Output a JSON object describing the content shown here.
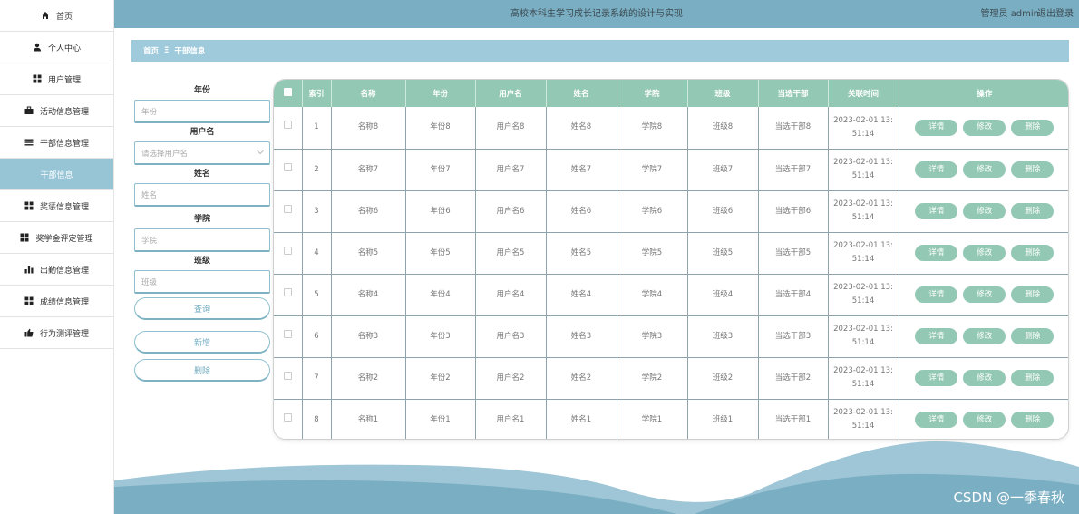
{
  "sidebar": {
    "items": [
      {
        "label": "首页",
        "icon": "home-icon"
      },
      {
        "label": "个人中心",
        "icon": "user-icon"
      },
      {
        "label": "用户管理",
        "icon": "grid-icon"
      },
      {
        "label": "活动信息管理",
        "icon": "briefcase-icon"
      },
      {
        "label": "干部信息管理",
        "icon": "list-icon"
      },
      {
        "label": "干部信息",
        "icon": "",
        "active": true
      },
      {
        "label": "奖惩信息管理",
        "icon": "grid-icon"
      },
      {
        "label": "奖学金评定管理",
        "icon": "grid-icon"
      },
      {
        "label": "出勤信息管理",
        "icon": "bar-chart-icon"
      },
      {
        "label": "成绩信息管理",
        "icon": "grid-icon"
      },
      {
        "label": "行为测评管理",
        "icon": "thumbs-up-icon"
      }
    ]
  },
  "header": {
    "title": "高校本科生学习成长记录系统的设计与实现",
    "user": "管理员 admin",
    "logout": "退出登录"
  },
  "breadcrumb": {
    "home": "首页",
    "separator": "Ξ",
    "current": "干部信息"
  },
  "search": {
    "year_label": "年份",
    "year_placeholder": "年份",
    "username_label": "用户名",
    "username_placeholder": "请选择用户名",
    "name_label": "姓名",
    "name_placeholder": "姓名",
    "college_label": "学院",
    "college_placeholder": "学院",
    "class_label": "班级",
    "class_placeholder": "班级",
    "query_button": "查询",
    "add_button": "新增",
    "delete_button": "删除"
  },
  "table": {
    "columns": [
      "索引",
      "名称",
      "年份",
      "用户名",
      "姓名",
      "学院",
      "班级",
      "当选干部",
      "关联时间",
      "操作"
    ],
    "rows": [
      [
        "1",
        "名称8",
        "年份8",
        "用户名8",
        "姓名8",
        "学院8",
        "班级8",
        "当选干部8",
        "2023-02-01 13:",
        "51:14"
      ],
      [
        "2",
        "名称7",
        "年份7",
        "用户名7",
        "姓名7",
        "学院7",
        "班级7",
        "当选干部7",
        "2023-02-01 13:",
        "51:14"
      ],
      [
        "3",
        "名称6",
        "年份6",
        "用户名6",
        "姓名6",
        "学院6",
        "班级6",
        "当选干部6",
        "2023-02-01 13:",
        "51:14"
      ],
      [
        "4",
        "名称5",
        "年份5",
        "用户名5",
        "姓名5",
        "学院5",
        "班级5",
        "当选干部5",
        "2023-02-01 13:",
        "51:14"
      ],
      [
        "5",
        "名称4",
        "年份4",
        "用户名4",
        "姓名4",
        "学院4",
        "班级4",
        "当选干部4",
        "2023-02-01 13:",
        "51:14"
      ],
      [
        "6",
        "名称3",
        "年份3",
        "用户名3",
        "姓名3",
        "学院3",
        "班级3",
        "当选干部3",
        "2023-02-01 13:",
        "51:14"
      ],
      [
        "7",
        "名称2",
        "年份2",
        "用户名2",
        "姓名2",
        "学院2",
        "班级2",
        "当选干部2",
        "2023-02-01 13:",
        "51:14"
      ],
      [
        "8",
        "名称1",
        "年份1",
        "用户名1",
        "姓名1",
        "学院1",
        "班级1",
        "当选干部1",
        "2023-02-01 13:",
        "51:14"
      ]
    ],
    "row_actions": {
      "detail": "详情",
      "edit": "修改",
      "delete": "删除"
    }
  },
  "watermark": "CSDN @一季春秋",
  "colors": {
    "header": "#7aaec3",
    "breadcrumb": "#9fcadb",
    "table_accent": "#93c8b4",
    "sidebar_active": "#98c5d6"
  }
}
